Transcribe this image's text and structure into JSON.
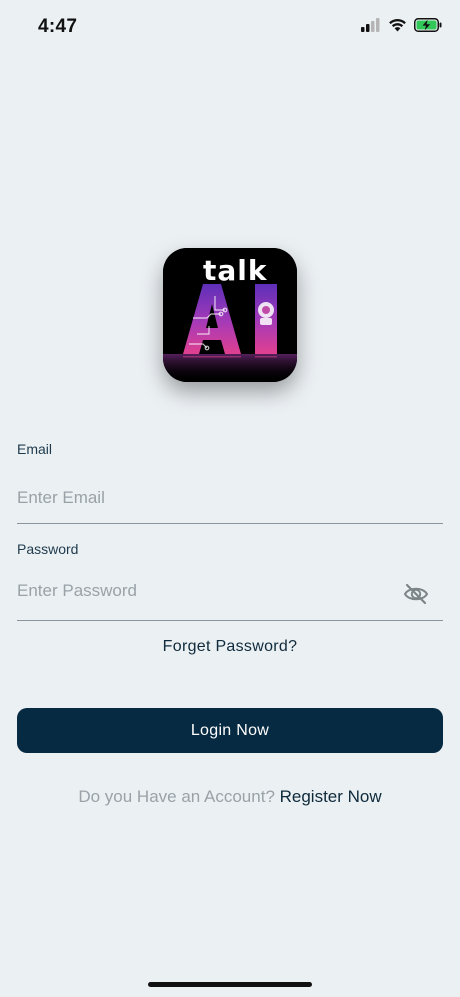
{
  "status_bar": {
    "time": "4:47"
  },
  "logo": {
    "top_text": "talk",
    "big_text": "AI"
  },
  "form": {
    "email_label": "Email",
    "email_placeholder": "Enter Email",
    "email_value": "",
    "password_label": "Password",
    "password_placeholder": "Enter Password",
    "password_value": ""
  },
  "actions": {
    "forgot_label": "Forget Password?",
    "login_label": "Login Now",
    "register_prompt": "Do you Have an Account?",
    "register_link": "Register Now"
  },
  "colors": {
    "background": "#ebf0f3",
    "primary_button": "#062a42",
    "text_dark": "#0e2a3b",
    "placeholder": "#9aa2a8",
    "battery_green": "#32c759"
  }
}
